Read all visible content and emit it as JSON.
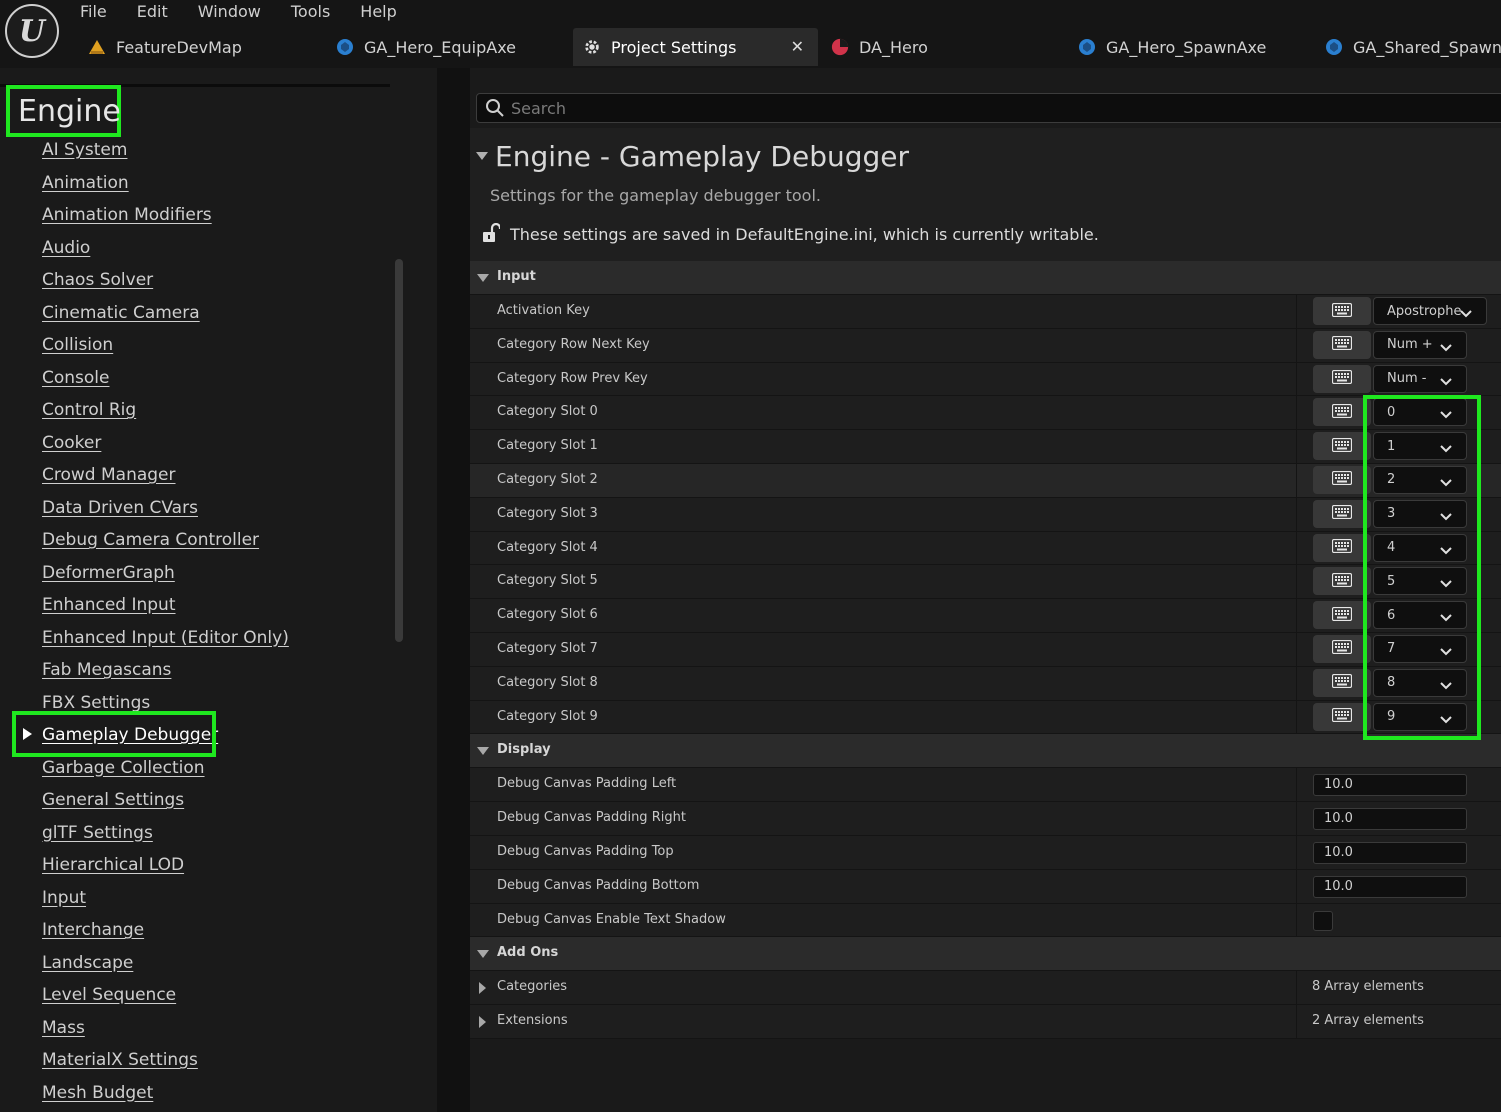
{
  "colors": {
    "highlight": "#1fe81f",
    "background": "#151515",
    "panel": "#1a1a1a"
  },
  "menu": [
    "File",
    "Edit",
    "Window",
    "Tools",
    "Help"
  ],
  "tabs": [
    {
      "label": "FeatureDevMap",
      "icon": "level-map-icon"
    },
    {
      "label": "GA_Hero_EquipAxe",
      "icon": "blueprint-icon"
    },
    {
      "label": "Project Settings",
      "icon": "settings-gear-icon",
      "active": true
    },
    {
      "label": "DA_Hero",
      "icon": "data-asset-icon"
    },
    {
      "label": "GA_Hero_SpawnAxe",
      "icon": "blueprint-icon"
    },
    {
      "label": "GA_Shared_Spawn",
      "icon": "blueprint-icon"
    }
  ],
  "left_panel": {
    "section_title": "Engine",
    "categories": [
      "AI System",
      "Animation",
      "Animation Modifiers",
      "Audio",
      "Chaos Solver",
      "Cinematic Camera",
      "Collision",
      "Console",
      "Control Rig",
      "Cooker",
      "Crowd Manager",
      "Data Driven CVars",
      "Debug Camera Controller",
      "DeformerGraph",
      "Enhanced Input",
      "Enhanced Input (Editor Only)",
      "Fab Megascans",
      "FBX Settings",
      "Gameplay Debugger",
      "Garbage Collection",
      "General Settings",
      "glTF Settings",
      "Hierarchical LOD",
      "Input",
      "Interchange",
      "Landscape",
      "Level Sequence",
      "Mass",
      "MaterialX Settings",
      "Mesh Budget"
    ],
    "selected": "Gameplay Debugger"
  },
  "search": {
    "placeholder": "Search",
    "value": ""
  },
  "section": {
    "title": "Engine - Gameplay Debugger",
    "subtitle": "Settings for the gameplay debugger tool.",
    "note": "These settings are saved in DefaultEngine.ini, which is currently writable."
  },
  "groups": {
    "input": {
      "label": "Input",
      "rows": [
        {
          "label": "Activation Key",
          "value": "Apostrophe"
        },
        {
          "label": "Category Row Next Key",
          "value": "Num +"
        },
        {
          "label": "Category Row Prev Key",
          "value": "Num -"
        },
        {
          "label": "Category Slot 0",
          "value": "0"
        },
        {
          "label": "Category Slot 1",
          "value": "1"
        },
        {
          "label": "Category Slot 2",
          "value": "2"
        },
        {
          "label": "Category Slot 3",
          "value": "3"
        },
        {
          "label": "Category Slot 4",
          "value": "4"
        },
        {
          "label": "Category Slot 5",
          "value": "5"
        },
        {
          "label": "Category Slot 6",
          "value": "6"
        },
        {
          "label": "Category Slot 7",
          "value": "7"
        },
        {
          "label": "Category Slot 8",
          "value": "8"
        },
        {
          "label": "Category Slot 9",
          "value": "9"
        }
      ]
    },
    "display": {
      "label": "Display",
      "rows": [
        {
          "label": "Debug Canvas Padding Left",
          "value": "10.0"
        },
        {
          "label": "Debug Canvas Padding Right",
          "value": "10.0"
        },
        {
          "label": "Debug Canvas Padding Top",
          "value": "10.0"
        },
        {
          "label": "Debug Canvas Padding Bottom",
          "value": "10.0"
        },
        {
          "label": "Debug Canvas Enable Text Shadow",
          "checked": false
        }
      ]
    },
    "addons": {
      "label": "Add Ons",
      "rows": [
        {
          "label": "Categories",
          "value": "8 Array elements"
        },
        {
          "label": "Extensions",
          "value": "2 Array elements"
        }
      ]
    }
  }
}
